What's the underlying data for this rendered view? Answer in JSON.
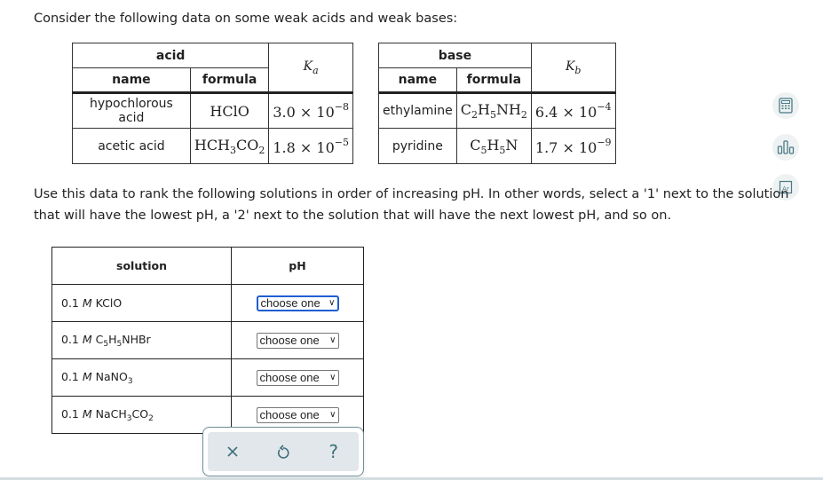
{
  "intro": "Consider the following data on some weak acids and weak bases:",
  "acid_table": {
    "group_header": "acid",
    "name_header": "name",
    "formula_header": "formula",
    "k_symbol": "K",
    "k_subscript": "a",
    "rows": [
      {
        "name": "hypochlorous acid",
        "formula_html": "HClO",
        "k_mantissa": "3.0",
        "k_exponent": "−8"
      },
      {
        "name": "acetic acid",
        "formula_html": "HCH<sub>3</sub>CO<sub>2</sub>",
        "k_mantissa": "1.8",
        "k_exponent": "−5"
      }
    ]
  },
  "base_table": {
    "group_header": "base",
    "name_header": "name",
    "formula_header": "formula",
    "k_symbol": "K",
    "k_subscript": "b",
    "rows": [
      {
        "name": "ethylamine",
        "formula_html": "C<sub>2</sub>H<sub>5</sub>NH<sub>2</sub>",
        "k_mantissa": "6.4",
        "k_exponent": "−4"
      },
      {
        "name": "pyridine",
        "formula_html": "C<sub>5</sub>H<sub>5</sub>N",
        "k_mantissa": "1.7",
        "k_exponent": "−9"
      }
    ]
  },
  "times_ten": "× 10",
  "instructions": "Use this data to rank the following solutions in order of increasing pH. In other words, select a '1' next to the solution that will have the lowest pH, a '2' next to the solution that will have the next lowest pH, and so on.",
  "solution_table": {
    "solution_header": "solution",
    "ph_header": "pH",
    "rows": [
      {
        "prefix": "0.1 ",
        "unit": "M",
        "formula_html": " KClO",
        "selected": "choose one",
        "focused": true
      },
      {
        "prefix": "0.1 ",
        "unit": "M",
        "formula_html": " C<sub>5</sub>H<sub>5</sub>NHBr",
        "selected": "choose one",
        "focused": false
      },
      {
        "prefix": "0.1 ",
        "unit": "M",
        "formula_html": " NaNO<sub>3</sub>",
        "selected": "choose one",
        "focused": false
      },
      {
        "prefix": "0.1 ",
        "unit": "M",
        "formula_html": " NaCH<sub>3</sub>CO<sub>2</sub>",
        "selected": "choose one",
        "focused": false
      }
    ]
  },
  "side_tools": [
    {
      "icon": "calculator-icon"
    },
    {
      "icon": "bar-chart-icon"
    },
    {
      "icon": "periodic-table-icon"
    }
  ],
  "action_bar": {
    "clear": "×",
    "undo": "↺",
    "help": "?"
  },
  "colors": {
    "focus_blue": "#1f5fd1",
    "action_icon": "#3f6f7c",
    "action_bg": "#e1e7ea",
    "tool_bg": "#eef2f3"
  }
}
